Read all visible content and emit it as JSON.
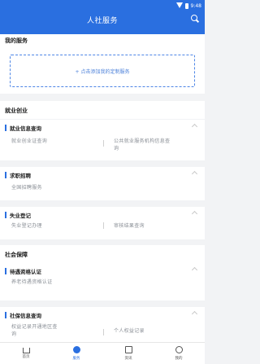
{
  "status_bar": {
    "time": "9:48"
  },
  "header": {
    "title": "人社服务"
  },
  "my_services": {
    "title": "我的服务",
    "add_label": "+ 点击添加我的定制服务"
  },
  "employment": {
    "title": "就业创业",
    "groups": [
      {
        "title": "就业信息查询",
        "items": [
          "就业创业证查询",
          "公共就业服务机构信息查询"
        ]
      },
      {
        "title": "求职招聘",
        "items": [
          "全国招聘服务"
        ]
      },
      {
        "title": "失业登记",
        "items": [
          "失业登记办理",
          "审核结果查询"
        ]
      }
    ]
  },
  "social_security": {
    "title": "社会保障",
    "groups": [
      {
        "title": "待遇资格认证",
        "items": [
          "养老待遇资格认证"
        ]
      },
      {
        "title": "社保信息查询",
        "items": [
          "权益记录开通地区查询",
          "个人权益记录"
        ]
      }
    ]
  },
  "bottom_nav": [
    {
      "label": "首页",
      "icon": "home-icon"
    },
    {
      "label": "服务",
      "icon": "service-icon"
    },
    {
      "label": "资讯",
      "icon": "news-icon"
    },
    {
      "label": "我的",
      "icon": "user-icon"
    }
  ],
  "colors": {
    "primary": "#2a6fe0"
  }
}
